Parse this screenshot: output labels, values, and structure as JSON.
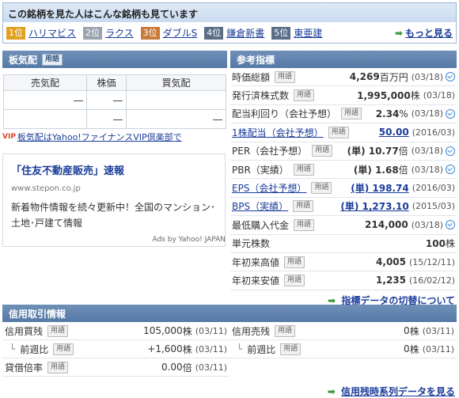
{
  "ranking": {
    "title": "この銘柄を見た人はこんな銘柄も見ています",
    "items": [
      {
        "rank": "1位",
        "name": "ハリマビス",
        "color": "#e0a020"
      },
      {
        "rank": "2位",
        "name": "ラクス",
        "color": "#9aa3ad"
      },
      {
        "rank": "3位",
        "name": "ダブルS",
        "color": "#c87a3a"
      },
      {
        "rank": "4位",
        "name": "鎌倉新書",
        "color": "#5a6e88"
      },
      {
        "rank": "5位",
        "name": "東亜建",
        "color": "#5a6e88"
      }
    ],
    "more": "もっと見る"
  },
  "board": {
    "title": "板気配",
    "yogo": "用語",
    "headers": [
      "売気配",
      "株価",
      "買気配"
    ],
    "rows": [
      [
        "―",
        "―",
        ""
      ],
      [
        "",
        "―",
        "―"
      ]
    ],
    "vip_badge": "VIP",
    "vip_text": "板気配はYahoo!ファイナンスVIP倶楽部で"
  },
  "ad": {
    "title": "「住友不動産販売」速報",
    "url": "www.stepon.co.jp",
    "body": "新着物件情報を続々更新中！全国のマンション･土地･戸建て情報",
    "credit": "Ads by Yahoo! JAPAN"
  },
  "indicators": {
    "title": "参考指標",
    "yogo": "用語",
    "rows": [
      {
        "label": "時価総額",
        "value": "4,269",
        "unit": "百万円",
        "date": "(03/18)",
        "clock": true,
        "link": false
      },
      {
        "label": "発行済株式数",
        "value": "1,995,000",
        "unit": "株",
        "date": "(03/18)",
        "clock": false,
        "link": false
      },
      {
        "label": "配当利回り（会社予想）",
        "value": "2.34",
        "unit": "%",
        "date": "(03/18)",
        "clock": true,
        "link": false
      },
      {
        "label": "1株配当（会社予想）",
        "value": "50.00",
        "unit": "",
        "date": "(2016/03)",
        "clock": false,
        "link": true
      },
      {
        "label": "PER（会社予想）",
        "value": "(単) 10.77",
        "unit": "倍",
        "date": "(03/18)",
        "clock": true,
        "link": false
      },
      {
        "label": "PBR（実績）",
        "value": "(単) 1.68",
        "unit": "倍",
        "date": "(03/18)",
        "clock": true,
        "link": false
      },
      {
        "label": "EPS（会社予想）",
        "value": "(単) 198.74",
        "unit": "",
        "date": "(2016/03)",
        "clock": false,
        "link": true
      },
      {
        "label": "BPS（実績）",
        "value": "(単) 1,273.10",
        "unit": "",
        "date": "(2015/03)",
        "clock": false,
        "link": true
      },
      {
        "label": "最低購入代金",
        "value": "214,000",
        "unit": "",
        "date": "(03/18)",
        "clock": true,
        "link": false
      },
      {
        "label": "単元株数",
        "value": "100",
        "unit": "株",
        "date": "",
        "clock": false,
        "link": false
      },
      {
        "label": "年初来高値",
        "value": "4,005",
        "unit": "",
        "date": "(15/12/11)",
        "clock": false,
        "link": false
      },
      {
        "label": "年初来安値",
        "value": "1,235",
        "unit": "",
        "date": "(16/02/12)",
        "clock": false,
        "link": false
      }
    ],
    "more": "指標データの切替について"
  },
  "credit": {
    "title": "信用取引情報",
    "yogo": "用語",
    "left": [
      {
        "label": "信用買残",
        "indent": false,
        "value": "105,000",
        "unit": "株",
        "date": "(03/11)"
      },
      {
        "label": "前週比",
        "indent": true,
        "value": "+1,600",
        "unit": "株",
        "date": "(03/11)"
      },
      {
        "label": "貸借倍率",
        "indent": false,
        "value": "0.00",
        "unit": "倍",
        "date": "(03/11)"
      }
    ],
    "right": [
      {
        "label": "信用売残",
        "indent": false,
        "value": "0",
        "unit": "株",
        "date": "(03/11)"
      },
      {
        "label": "前週比",
        "indent": true,
        "value": "0",
        "unit": "株",
        "date": "(03/11)"
      }
    ],
    "more": "信用残時系列データを見る"
  }
}
